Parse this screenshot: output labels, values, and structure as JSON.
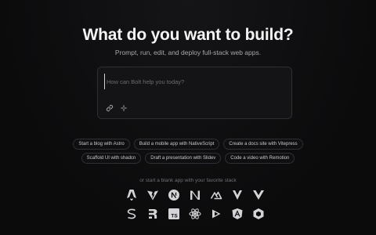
{
  "hero": {
    "title": "What do you want to build?",
    "subtitle": "Prompt, run, edit, and deploy full-stack web apps."
  },
  "prompt": {
    "placeholder": "How can Bolt help you today?",
    "tools": [
      "link-icon",
      "sparkle-icon"
    ]
  },
  "suggestions": {
    "row1": [
      "Start a blog with Astro",
      "Build a mobile app with NativeScript",
      "Create a docs site with Vitepress"
    ],
    "row2": [
      "Scaffold UI with shadcn",
      "Draft a presentation with Slidev",
      "Code a video with Remotion"
    ]
  },
  "starters": {
    "label": "or start a blank app with your favorite stack",
    "icons_row1": [
      "astro-icon",
      "vite-icon",
      "next-icon",
      "nuxt-icon",
      "nuxt-alt-icon",
      "svelte-icon",
      "vue-icon"
    ],
    "icons_row2": [
      "solid-icon",
      "remix-icon",
      "typescript-icon",
      "react-icon",
      "qwik-icon",
      "angular-icon",
      "preact-icon"
    ]
  },
  "colors": {
    "background": "#0b0b0c",
    "text": "#f4f4f5",
    "muted": "#a7a7ad",
    "border": "#2e2e33"
  }
}
